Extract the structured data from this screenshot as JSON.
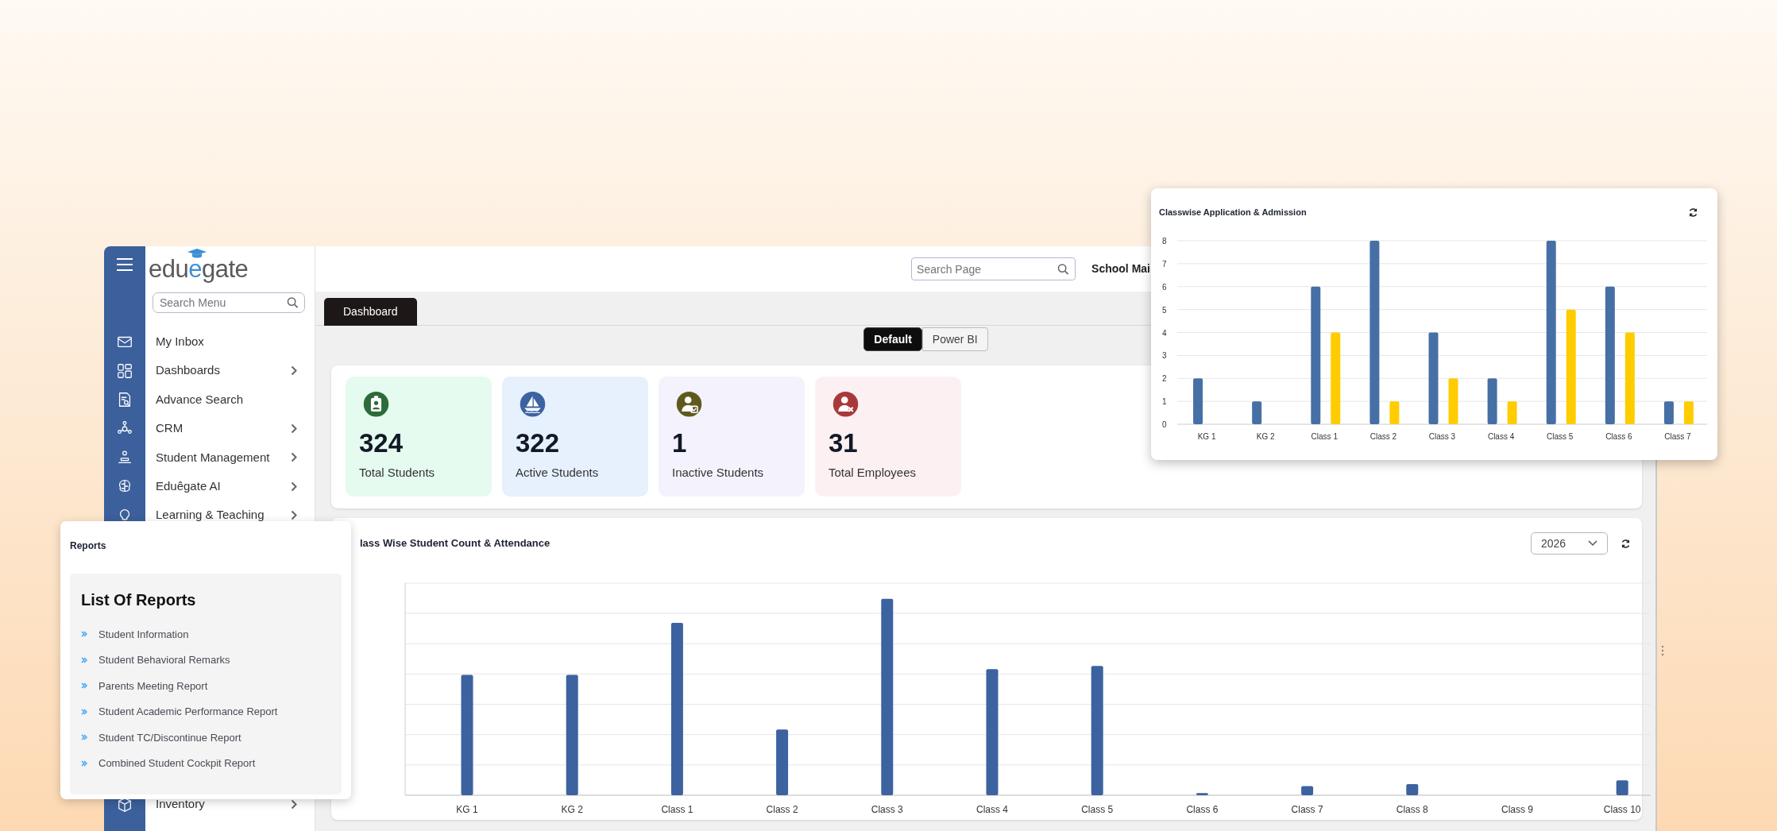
{
  "sidebar": {
    "logo_parts": [
      "edu",
      "e",
      "gate"
    ],
    "search": {
      "placeholder": "Search Menu"
    },
    "items": [
      {
        "label": "My Inbox",
        "kind": "envelope",
        "has_submenu": false
      },
      {
        "label": "Dashboards",
        "kind": "grid",
        "has_submenu": true
      },
      {
        "label": "Advance Search",
        "kind": "doc-search",
        "has_submenu": false
      },
      {
        "label": "CRM",
        "kind": "network",
        "has_submenu": true
      },
      {
        "label": "Student Management",
        "kind": "person-desk",
        "has_submenu": true
      },
      {
        "label": "Eduêgate AI",
        "kind": "brain",
        "has_submenu": true
      },
      {
        "label": "Learning & Teaching",
        "kind": "bulb",
        "has_submenu": true
      }
    ],
    "lower_items": [
      {
        "label": "Inventory",
        "kind": "box",
        "has_submenu": true
      }
    ]
  },
  "header": {
    "search": {
      "placeholder": "Search Page"
    },
    "school": "School Mai"
  },
  "tabs": [
    {
      "label": "Dashboard",
      "selected": true
    }
  ],
  "view_toggle": [
    {
      "label": "Default",
      "selected": true
    },
    {
      "label": "Power BI",
      "selected": false
    }
  ],
  "stats": [
    {
      "value": "324",
      "label": "Total Students",
      "kind": "id-badge",
      "color": "#2e6b3a"
    },
    {
      "value": "322",
      "label": "Active Students",
      "kind": "sailboat",
      "color": "#3c62a0"
    },
    {
      "value": "1",
      "label": "Inactive Students",
      "kind": "person-check",
      "color": "#5e5a1e"
    },
    {
      "value": "31",
      "label": "Total Employees",
      "kind": "person-x",
      "color": "#a8393b"
    }
  ],
  "attendance_chart": {
    "title": "lass Wise Student Count & Attendance",
    "year": "2026",
    "x_labels": [
      "KG 1",
      "KG 2",
      "Class 1",
      "Class 2",
      "Class 3",
      "Class 4",
      "Class 5",
      "Class 6",
      "Class 7",
      "Class 8",
      "Class 9",
      "Class 10"
    ]
  },
  "reports": {
    "title": "Reports",
    "heading": "List Of Reports",
    "items": [
      "Student Information",
      "Student Behavioral Remarks",
      "Parents Meeting Report",
      "Student Academic Performance Report",
      "Student TC/Discontinue Report",
      "Combined Student Cockpit Report"
    ]
  },
  "admission_chart": {
    "title": "Classwise Application & Admission",
    "chart_data": {
      "type": "bar",
      "categories": [
        "KG 1",
        "KG 2",
        "Class 1",
        "Class 2",
        "Class 3",
        "Class 4",
        "Class 5",
        "Class 6",
        "Class 7"
      ],
      "series": [
        {
          "color": "#466fa6",
          "values": [
            2,
            1,
            6,
            8,
            4,
            2,
            8,
            6,
            1
          ]
        },
        {
          "color": "#ffcc00",
          "values": [
            0,
            0,
            4,
            1,
            2,
            1,
            5,
            4,
            1
          ]
        }
      ],
      "grid": true,
      "ylim": [
        0,
        8
      ],
      "yticks": [
        0,
        1,
        2,
        3,
        4,
        5,
        6,
        7,
        8
      ]
    }
  }
}
